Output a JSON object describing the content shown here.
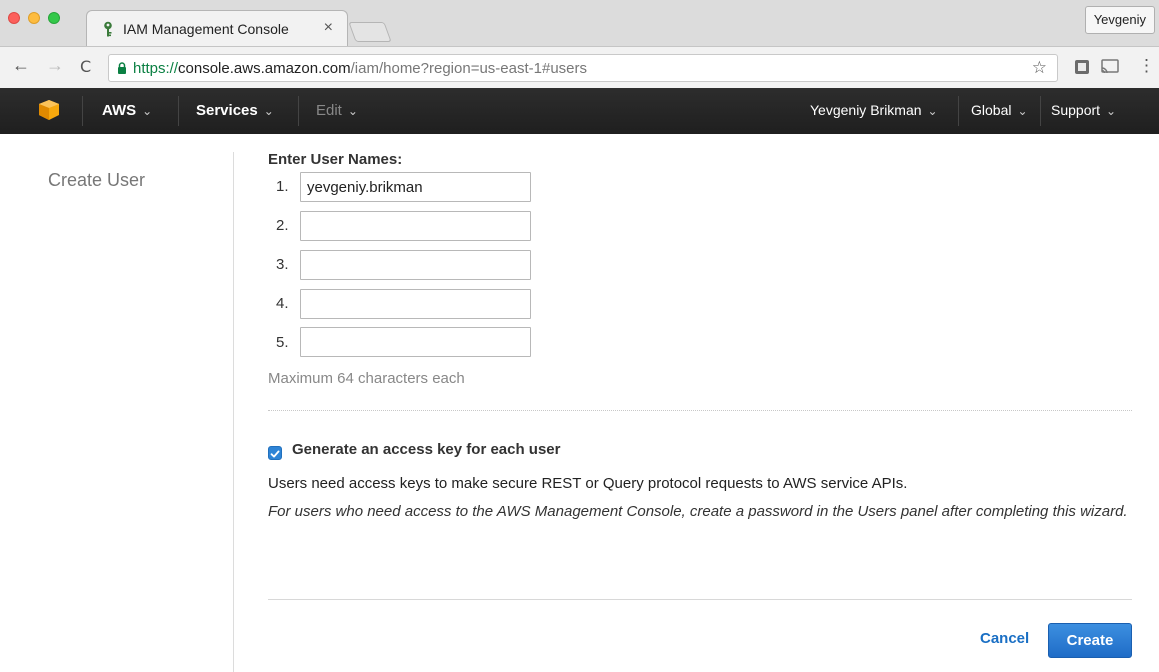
{
  "browser": {
    "tab_title": "IAM Management Console",
    "tab_close": "×",
    "profile": "Yevgeniy",
    "url_scheme": "https://",
    "url_host": "console.aws.amazon.com",
    "url_path": "/iam/home?region=us-east-1#users",
    "back": "←",
    "forward": "→",
    "reload": "C",
    "star": "☆",
    "menu": "⋮"
  },
  "aws_nav": {
    "aws": "AWS",
    "services": "Services",
    "edit": "Edit",
    "user": "Yevgeniy Brikman",
    "region": "Global",
    "support": "Support",
    "caret": "⌄",
    "logo_color": "#f7a80d"
  },
  "sidebar": {
    "title": "Create User"
  },
  "form": {
    "label": "Enter User Names:",
    "rows": [
      {
        "num": "1.",
        "value": "yevgeniy.brikman"
      },
      {
        "num": "2.",
        "value": ""
      },
      {
        "num": "3.",
        "value": ""
      },
      {
        "num": "4.",
        "value": ""
      },
      {
        "num": "5.",
        "value": ""
      }
    ],
    "hint": "Maximum 64 characters each",
    "checkbox_checked": true,
    "checkbox_label": "Generate an access key for each user",
    "description": "Users need access keys to make secure REST or Query protocol requests to AWS service APIs.",
    "note": "For users who need access to the AWS Management Console, create a password in the Users panel after completing this wizard."
  },
  "actions": {
    "cancel": "Cancel",
    "create": "Create",
    "primary_color": "#2a7ad6"
  }
}
